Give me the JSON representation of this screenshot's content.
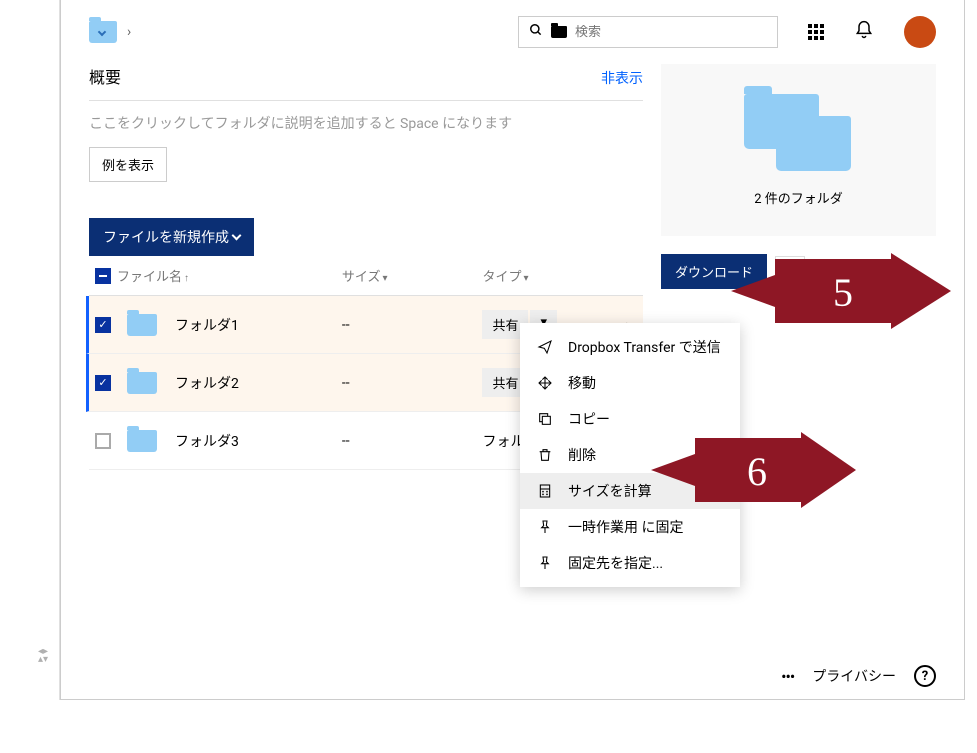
{
  "search": {
    "placeholder": "検索"
  },
  "overview": {
    "title": "概要",
    "hide": "非表示",
    "hint": "ここをクリックしてフォルダに説明を追加すると Space になります",
    "example_btn": "例を表示"
  },
  "create_btn": "ファイルを新規作成",
  "columns": {
    "name": "ファイル名",
    "size": "サイズ",
    "type": "タイプ"
  },
  "rows": [
    {
      "name": "フォルダ1",
      "size": "--",
      "type": "share",
      "selected": true
    },
    {
      "name": "フォルダ2",
      "size": "--",
      "type": "share",
      "selected": true
    },
    {
      "name": "フォルダ3",
      "size": "--",
      "type": "フォルダ",
      "selected": false
    }
  ],
  "share_label": "共有",
  "preview": {
    "caption": "2 件のフォルダ"
  },
  "download": "ダウンロード",
  "menu": [
    {
      "label": "Dropbox Transfer で送信",
      "icon": "send"
    },
    {
      "label": "移動",
      "icon": "move"
    },
    {
      "label": "コピー",
      "icon": "copy"
    },
    {
      "label": "削除",
      "icon": "delete"
    },
    {
      "label": "サイズを計算",
      "icon": "calculator",
      "hover": true
    },
    {
      "label": "一時作業用 に固定",
      "icon": "pin"
    },
    {
      "label": "固定先を指定...",
      "icon": "pin"
    }
  ],
  "callouts": {
    "a": "5",
    "b": "6"
  },
  "footer": {
    "privacy": "プライバシー"
  }
}
